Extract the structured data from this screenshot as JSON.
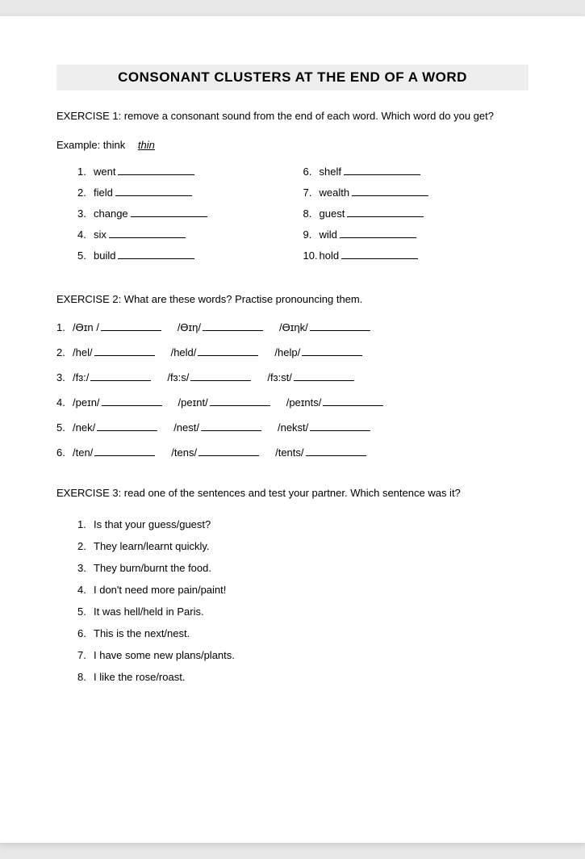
{
  "title": "CONSONANT CLUSTERS AT THE END OF A WORD",
  "exercise1": {
    "intro": "EXERCISE 1: remove a consonant sound from the end of each word. Which word do you get?",
    "example_label": "Example: think",
    "example_answer": "thin",
    "left": [
      {
        "n": "1.",
        "w": "went"
      },
      {
        "n": "2.",
        "w": "field"
      },
      {
        "n": "3.",
        "w": "change"
      },
      {
        "n": "4.",
        "w": "six"
      },
      {
        "n": "5.",
        "w": "build"
      }
    ],
    "right": [
      {
        "n": "6.",
        "w": "shelf"
      },
      {
        "n": "7.",
        "w": "wealth"
      },
      {
        "n": "8.",
        "w": "guest"
      },
      {
        "n": "9.",
        "w": "wild"
      },
      {
        "n": "10.",
        "w": "hold"
      }
    ]
  },
  "exercise2": {
    "intro": "EXERCISE 2: What are these words? Practise pronouncing them.",
    "rows": [
      {
        "n": "1.",
        "a": "/Ɵɪn /",
        "b": "/Ɵɪη/",
        "c": "/Ɵɪηk/"
      },
      {
        "n": "2.",
        "a": "/hel/",
        "b": "/held/",
        "c": "/help/"
      },
      {
        "n": "3.",
        "a": "/fɜ:/",
        "b": "/fɜ:s/",
        "c": "/fɜ:st/"
      },
      {
        "n": "4.",
        "a": "/peɪn/",
        "b": "/peɪnt/",
        "c": "/peɪnts/"
      },
      {
        "n": "5.",
        "a": "/nek/",
        "b": "/nest/",
        "c": "/nekst/"
      },
      {
        "n": "6.",
        "a": "/ten/",
        "b": "/tens/",
        "c": "/tents/"
      }
    ]
  },
  "exercise3": {
    "intro": "EXERCISE 3: read one of the sentences and test your partner. Which sentence was it?",
    "items": [
      {
        "n": "1.",
        "t": "Is that your guess/guest?"
      },
      {
        "n": "2.",
        "t": "They learn/learnt quickly."
      },
      {
        "n": "3.",
        "t": "They burn/burnt the food."
      },
      {
        "n": "4.",
        "t": "I don't need more pain/paint!"
      },
      {
        "n": "5.",
        "t": "It was hell/held in Paris."
      },
      {
        "n": "6.",
        "t": "This is the next/nest."
      },
      {
        "n": "7.",
        "t": "I have some new plans/plants."
      },
      {
        "n": "8.",
        "t": "I like the rose/roast."
      }
    ]
  }
}
